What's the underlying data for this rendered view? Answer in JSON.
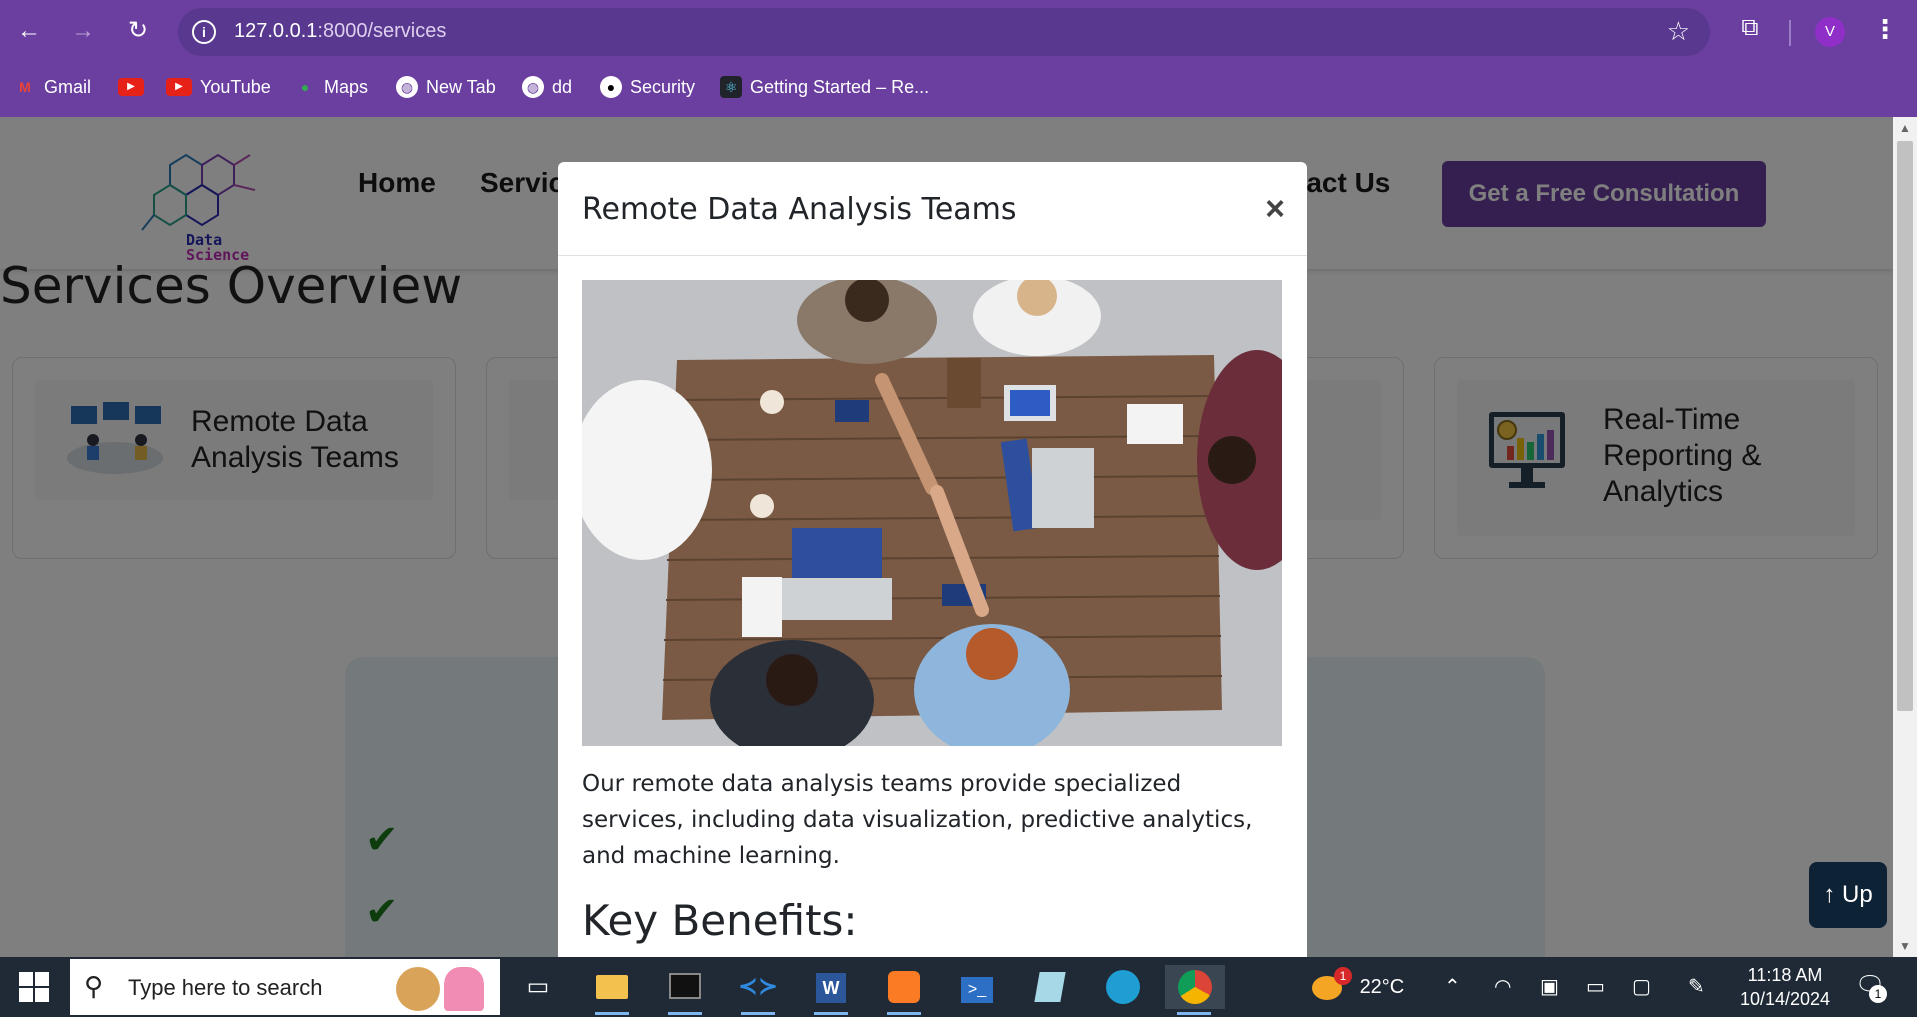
{
  "browser": {
    "url_host": "127.0.0.1",
    "url_path": ":8000/services",
    "profile_initial": "V",
    "bookmarks": [
      {
        "label": "Gmail",
        "icon": "gmail-icon"
      },
      {
        "label": "",
        "icon": "youtube-icon"
      },
      {
        "label": "YouTube",
        "icon": "youtube-icon"
      },
      {
        "label": "Maps",
        "icon": "maps-icon"
      },
      {
        "label": "New Tab",
        "icon": "globe-icon"
      },
      {
        "label": "dd",
        "icon": "globe-icon"
      },
      {
        "label": "Security",
        "icon": "github-icon"
      },
      {
        "label": "Getting Started – Re...",
        "icon": "react-icon"
      }
    ]
  },
  "site": {
    "logo_line1": "Data",
    "logo_line2": "Science",
    "nav": {
      "home": "Home",
      "services": "Servic",
      "contact": "tact Us"
    },
    "cta": "Get a Free Consultation",
    "services_title": "Services Overview",
    "cards": [
      {
        "line1": "Remote Data",
        "line2": "Analysis Teams",
        "line3": ""
      },
      {
        "line1": "Real-Time",
        "line2": "Reporting &",
        "line3": "Analytics"
      }
    ],
    "up_button": "↑ Up"
  },
  "modal": {
    "title": "Remote Data Analysis Teams",
    "close": "×",
    "description": "Our remote data analysis teams provide specialized services, including data visualization, predictive analytics, and machine learning.",
    "subheading": "Key Benefits:"
  },
  "taskbar": {
    "search_placeholder": "Type here to search",
    "weather": "22°C",
    "weather_badge": "1",
    "time": "11:18 AM",
    "date": "10/14/2024",
    "notif_count": "1"
  },
  "colors": {
    "brand": "#6b3fa0",
    "taskbar": "#1f2a36",
    "check": "#1b7a1b"
  }
}
